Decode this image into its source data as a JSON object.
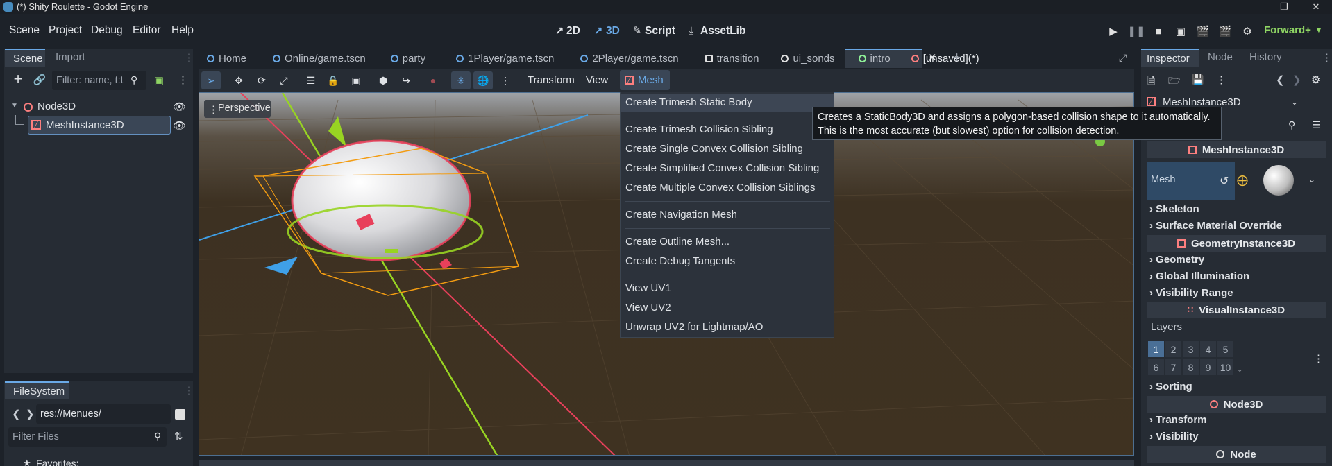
{
  "window": {
    "title": "(*) Shity Roulette - Godot Engine",
    "controls": [
      "—",
      "❐",
      "✕"
    ]
  },
  "menubar": {
    "items": [
      "Scene",
      "Project",
      "Debug",
      "Editor",
      "Help"
    ],
    "workspaces": [
      "2D",
      "3D",
      "Script",
      "AssetLib"
    ],
    "renderer": "Forward+"
  },
  "scene_dock": {
    "tabs": [
      "Scene",
      "Import"
    ],
    "filter_placeholder": "Filter: name, t:t",
    "tree": [
      {
        "label": "Node3D"
      },
      {
        "label": "MeshInstance3D"
      }
    ]
  },
  "filesystem": {
    "tab": "FileSystem",
    "path": "res://Menues/",
    "filter_placeholder": "Filter Files",
    "favorites": "Favorites:"
  },
  "scene_tabs": [
    {
      "label": "Home",
      "color": "#6aa9e6"
    },
    {
      "label": "Online/game.tscn",
      "color": "#6aa9e6"
    },
    {
      "label": "party",
      "color": "#6aa9e6"
    },
    {
      "label": "1Player/game.tscn",
      "color": "#6aa9e6"
    },
    {
      "label": "2Player/game.tscn",
      "color": "#6aa9e6"
    },
    {
      "label": "transition",
      "color": "#e0e0e0"
    },
    {
      "label": "ui_sonds",
      "color": "#e0e0e0"
    },
    {
      "label": "intro",
      "color": "#8eef97"
    },
    {
      "label": "[unsaved](*)",
      "color": "#fc7f7f"
    }
  ],
  "toolbar": {
    "transform": "Transform",
    "view": "View",
    "mesh": "Mesh"
  },
  "viewport": {
    "perspective": "Perspective"
  },
  "mesh_menu": {
    "groups": [
      [
        "Create Trimesh Static Body"
      ],
      [
        "Create Trimesh Collision Sibling",
        "Create Single Convex Collision Sibling",
        "Create Simplified Convex Collision Sibling",
        "Create Multiple Convex Collision Siblings"
      ],
      [
        "Create Navigation Mesh"
      ],
      [
        "Create Outline Mesh...",
        "Create Debug Tangents"
      ],
      [
        "View UV1",
        "View UV2",
        "Unwrap UV2 for Lightmap/AO"
      ]
    ]
  },
  "tooltip": {
    "line1": "Creates a StaticBody3D and assigns a polygon-based collision shape to it automatically.",
    "line2": "This is the most accurate (but slowest) option for collision detection."
  },
  "inspector": {
    "tabs": [
      "Inspector",
      "Node",
      "History"
    ],
    "object": "MeshInstance3D",
    "class_headers": {
      "mesh_instance": "MeshInstance3D",
      "geometry_instance": "GeometryInstance3D",
      "visual_instance": "VisualInstance3D",
      "node3d": "Node3D",
      "node": "Node"
    },
    "mesh_label": "Mesh",
    "sections_a": [
      "Skeleton",
      "Surface Material Override"
    ],
    "sections_b": [
      "Geometry",
      "Global Illumination",
      "Visibility Range"
    ],
    "layers_label": "Layers",
    "layers_row1": [
      "1",
      "2",
      "3",
      "4",
      "5"
    ],
    "layers_row2": [
      "6",
      "7",
      "8",
      "9",
      "10"
    ],
    "sections_c": [
      "Sorting"
    ],
    "sections_d": [
      "Transform",
      "Visibility"
    ]
  }
}
